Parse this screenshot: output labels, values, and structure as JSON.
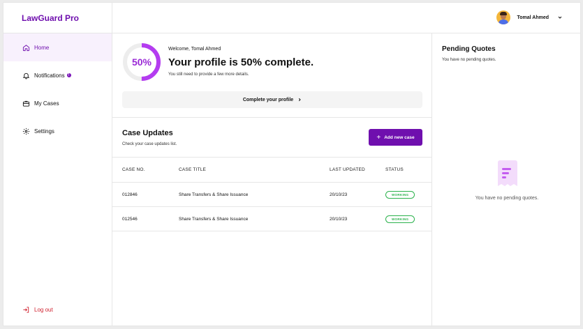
{
  "app": {
    "name": "LawGuard Pro",
    "brand_color": "#6f0fae"
  },
  "sidebar": {
    "items": [
      {
        "label": "Home",
        "icon": "home-icon",
        "active": true
      },
      {
        "label": "Notifications",
        "icon": "bell-icon",
        "badge": "!"
      },
      {
        "label": "My Cases",
        "icon": "briefcase-icon"
      },
      {
        "label": "Settings",
        "icon": "gear-icon"
      }
    ],
    "logout_label": "Log out"
  },
  "topbar": {
    "user_name": "Tomal Ahmed"
  },
  "profile": {
    "percent_label": "50%",
    "progress": 0.5,
    "welcome": "Welcome, Tomal Ahmed",
    "headline": "Your profile is 50% complete.",
    "sub": "You still need to provide a few more details.",
    "cta": "Complete your profile"
  },
  "updates": {
    "title": "Case Updates",
    "sub": "Check your case updates list.",
    "add_label": "Add new case",
    "columns": [
      "CASE NO.",
      "CASE TITLE",
      "LAST UPDATED",
      "STATUS"
    ],
    "rows": [
      {
        "case_no": "012846",
        "title": "Share Transfers & Share Issuance",
        "updated": "20/10/23",
        "status": "WORKING"
      },
      {
        "case_no": "012546",
        "title": "Share Transfers & Share Issuance",
        "updated": "20/10/23",
        "status": "WORKING"
      }
    ]
  },
  "quotes": {
    "title": "Pending Quotes",
    "sub": "You have no pending quotes.",
    "empty": "You have no pending quotes."
  }
}
